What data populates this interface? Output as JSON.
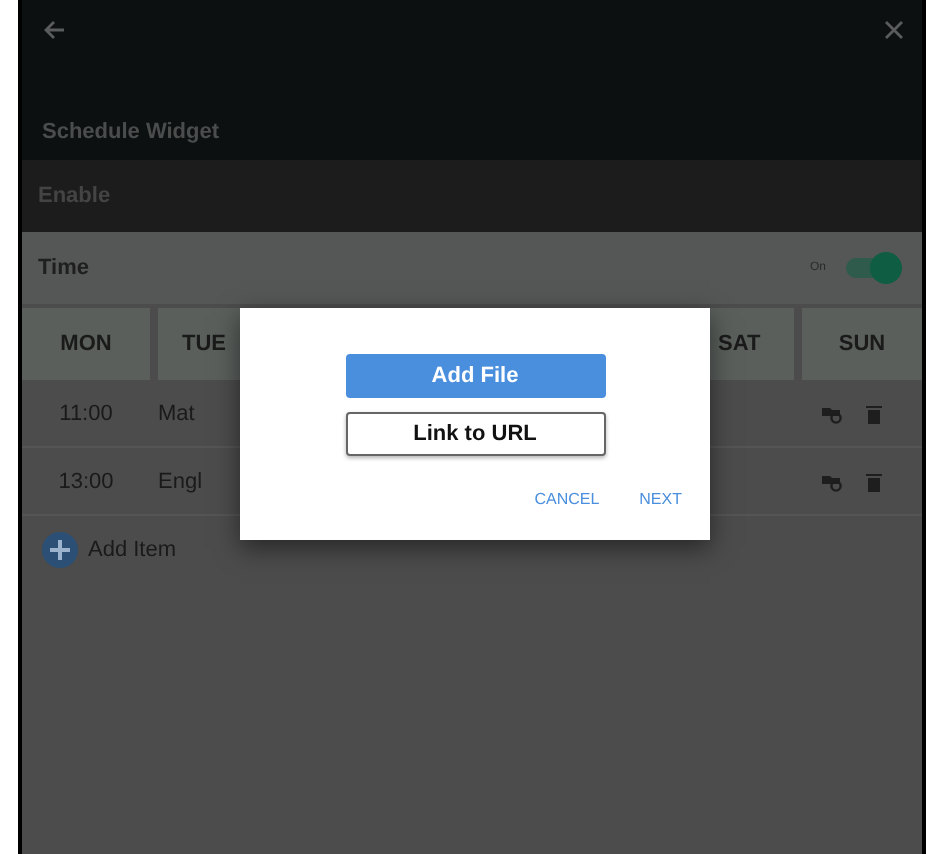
{
  "top_bar": {
    "title": "Schedule Widget"
  },
  "enable_row": {
    "label": "Enable"
  },
  "time_row": {
    "label": "Time",
    "switch_label": "On",
    "on": true
  },
  "table": {
    "columns": [
      "MON",
      "TUE",
      "SAT",
      "SUN"
    ],
    "rows": [
      {
        "time": "11:00",
        "subject": "Mat"
      },
      {
        "time": "13:00",
        "subject": "Engl"
      }
    ]
  },
  "add_item": {
    "label": "Add Item"
  },
  "dialog": {
    "buttons": [
      {
        "label": "Add File",
        "kind": "primary"
      },
      {
        "label": "Link to URL",
        "kind": "outline"
      }
    ],
    "actions": [
      "CANCEL",
      "NEXT"
    ]
  }
}
